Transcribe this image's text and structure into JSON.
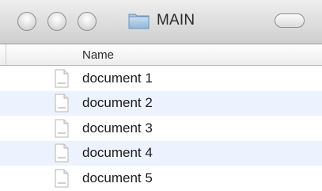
{
  "window": {
    "title": "MAIN"
  },
  "header": {
    "columns": [
      {
        "label": "Name"
      }
    ]
  },
  "files": [
    {
      "name": "document 1",
      "icon": "document-icon"
    },
    {
      "name": "document 2",
      "icon": "document-icon"
    },
    {
      "name": "document 3",
      "icon": "document-icon"
    },
    {
      "name": "document 4",
      "icon": "document-icon"
    },
    {
      "name": "document 5",
      "icon": "document-icon"
    }
  ],
  "colors": {
    "stripe": "#edf3fe",
    "titlebar_top": "#eeeeee",
    "titlebar_bottom": "#cfcfcf"
  }
}
